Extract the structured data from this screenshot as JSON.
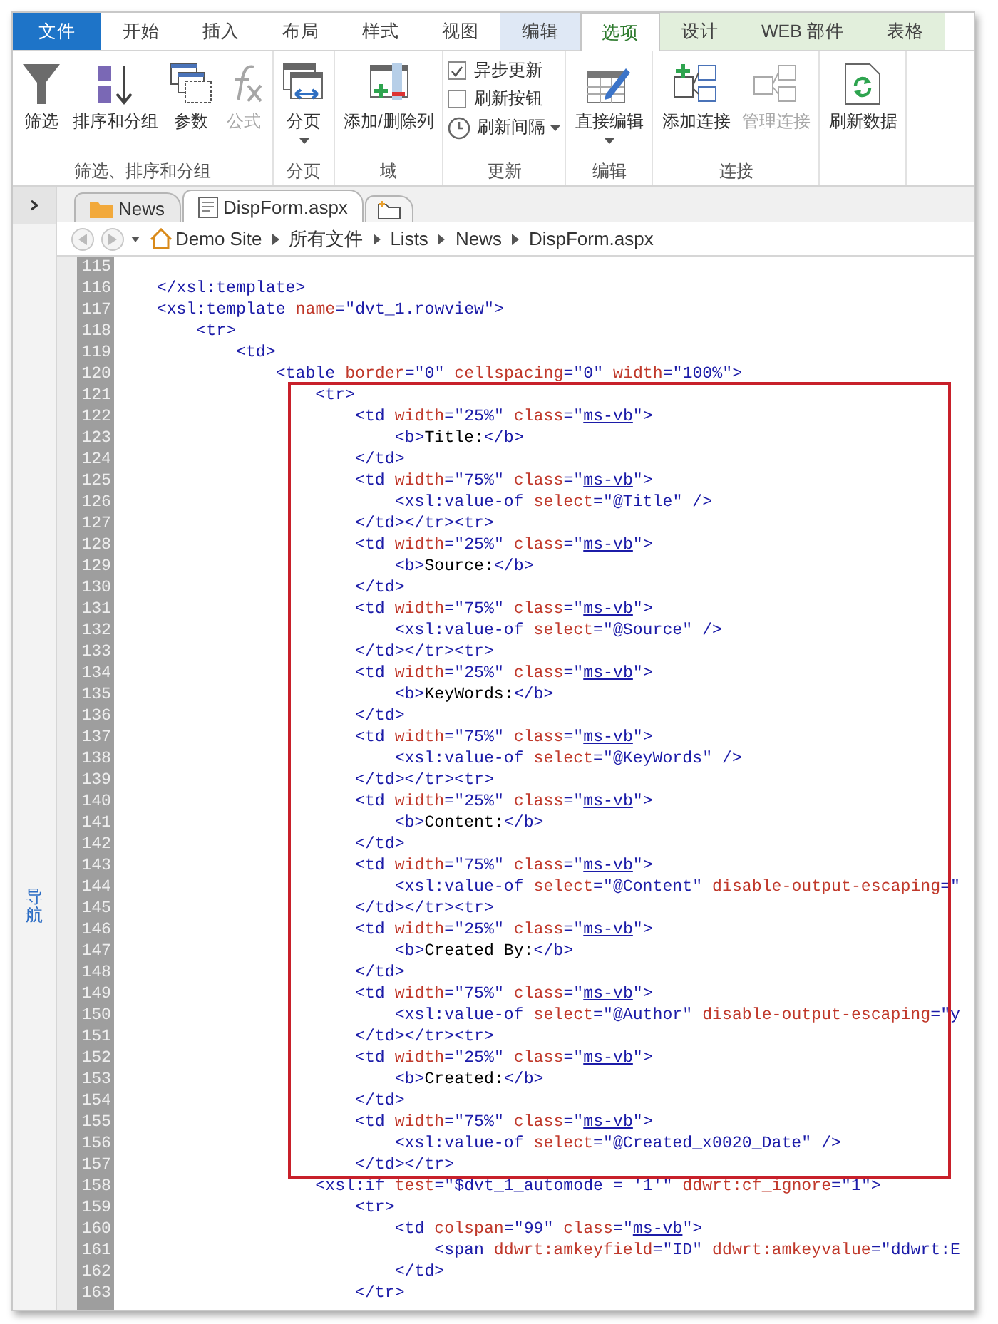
{
  "ribbon": {
    "tabs": [
      {
        "label": "文件",
        "kind": "file",
        "selected": false
      },
      {
        "label": "开始",
        "kind": "plain",
        "selected": false
      },
      {
        "label": "插入",
        "kind": "plain",
        "selected": false
      },
      {
        "label": "布局",
        "kind": "plain",
        "selected": false
      },
      {
        "label": "样式",
        "kind": "plain",
        "selected": false
      },
      {
        "label": "视图",
        "kind": "plain",
        "selected": false
      },
      {
        "label": "编辑",
        "kind": "context",
        "color": "#dfe8f5",
        "selected": false
      },
      {
        "label": "选项",
        "kind": "context",
        "selected": true
      },
      {
        "label": "设计",
        "kind": "context",
        "color": "#e2efdc",
        "selected": false
      },
      {
        "label": "WEB 部件",
        "kind": "context",
        "color": "#e2efdc",
        "selected": false
      },
      {
        "label": "表格",
        "kind": "context",
        "color": "#e2efdc",
        "selected": false
      }
    ],
    "groups": [
      {
        "label": "筛选、排序和分组",
        "items": [
          {
            "kind": "large",
            "label": "筛选",
            "disabled": false,
            "dropdown": false
          },
          {
            "kind": "large",
            "label": "排序和分组",
            "disabled": false,
            "dropdown": false
          },
          {
            "kind": "large",
            "label": "参数",
            "disabled": false,
            "dropdown": false
          },
          {
            "kind": "large",
            "label": "公式",
            "disabled": true,
            "dropdown": false
          }
        ]
      },
      {
        "label": "分页",
        "items": [
          {
            "kind": "large",
            "label": "分页",
            "disabled": false,
            "dropdown": true
          }
        ]
      },
      {
        "label": "域",
        "items": [
          {
            "kind": "large",
            "label": "添加/删除列",
            "disabled": false,
            "dropdown": false
          }
        ]
      },
      {
        "label": "更新",
        "items": [
          {
            "kind": "check",
            "label": "异步更新",
            "checked": true
          },
          {
            "kind": "check",
            "label": "刷新按钮",
            "checked": false
          },
          {
            "kind": "small",
            "label": "刷新间隔",
            "disabled": false,
            "dropdown": true
          }
        ]
      },
      {
        "label": "编辑",
        "items": [
          {
            "kind": "large",
            "label": "直接编辑",
            "disabled": false,
            "dropdown": true
          }
        ]
      },
      {
        "label": "连接",
        "items": [
          {
            "kind": "large",
            "label": "添加连接",
            "disabled": false,
            "dropdown": false
          },
          {
            "kind": "large",
            "label": "管理连接",
            "disabled": true,
            "dropdown": false
          }
        ]
      },
      {
        "items": [
          {
            "kind": "large",
            "label": "刷新数据",
            "disabled": false,
            "dropdown": false
          }
        ]
      }
    ]
  },
  "nav_pane": {
    "label": "导航"
  },
  "document_tabs": [
    {
      "label": "News",
      "kind": "folder",
      "selected": false
    },
    {
      "label": "DispForm.aspx",
      "kind": "page",
      "selected": true
    }
  ],
  "breadcrumb": [
    "Demo Site",
    "所有文件",
    "Lists",
    "News",
    "DispForm.aspx"
  ],
  "code_lines": [
    {
      "n": "115"
    },
    {
      "n": "116",
      "code": "    </xsl:template>"
    },
    {
      "n": "117",
      "code": "    <xsl:template name=\"dvt_1.rowview\">",
      "link": false
    },
    {
      "n": "118",
      "code": "        <tr>"
    },
    {
      "n": "119",
      "code": "            <td>"
    },
    {
      "n": "120",
      "code": "                <table border=\"0\" cellspacing=\"0\" width=\"100%\">",
      "link": false
    },
    {
      "n": "121",
      "code": "                    <tr>"
    },
    {
      "n": "122",
      "code": "                        <td width=\"25%\" class=\"ms-vb\">",
      "link": true
    },
    {
      "n": "123",
      "code": "                            <b>Title:</b>"
    },
    {
      "n": "124",
      "code": "                        </td>"
    },
    {
      "n": "125",
      "code": "                        <td width=\"75%\" class=\"ms-vb\">",
      "link": true
    },
    {
      "n": "126",
      "code": "                            <xsl:value-of select=\"@Title\" />",
      "link": false
    },
    {
      "n": "127",
      "code": "                        </td></tr><tr>"
    },
    {
      "n": "128",
      "code": "                        <td width=\"25%\" class=\"ms-vb\">",
      "link": true
    },
    {
      "n": "129",
      "code": "                            <b>Source:</b>"
    },
    {
      "n": "130",
      "code": "                        </td>"
    },
    {
      "n": "131",
      "code": "                        <td width=\"75%\" class=\"ms-vb\">",
      "link": true
    },
    {
      "n": "132",
      "code": "                            <xsl:value-of select=\"@Source\" />",
      "link": false
    },
    {
      "n": "133",
      "code": "                        </td></tr><tr>"
    },
    {
      "n": "134",
      "code": "                        <td width=\"25%\" class=\"ms-vb\">",
      "link": true
    },
    {
      "n": "135",
      "code": "                            <b>KeyWords:</b>"
    },
    {
      "n": "136",
      "code": "                        </td>"
    },
    {
      "n": "137",
      "code": "                        <td width=\"75%\" class=\"ms-vb\">",
      "link": true
    },
    {
      "n": "138",
      "code": "                            <xsl:value-of select=\"@KeyWords\" />",
      "link": false
    },
    {
      "n": "139",
      "code": "                        </td></tr><tr>"
    },
    {
      "n": "140",
      "code": "                        <td width=\"25%\" class=\"ms-vb\">",
      "link": true
    },
    {
      "n": "141",
      "code": "                            <b>Content:</b>"
    },
    {
      "n": "142",
      "code": "                        </td>"
    },
    {
      "n": "143",
      "code": "                        <td width=\"75%\" class=\"ms-vb\">",
      "link": true
    },
    {
      "n": "144",
      "code": "                            <xsl:value-of select=\"@Content\" disable-output-escaping=\""
    },
    {
      "n": "145",
      "code": "                        </td></tr><tr>"
    },
    {
      "n": "146",
      "code": "                        <td width=\"25%\" class=\"ms-vb\">",
      "link": true
    },
    {
      "n": "147",
      "code": "                            <b>Created By:</b>"
    },
    {
      "n": "148",
      "code": "                        </td>"
    },
    {
      "n": "149",
      "code": "                        <td width=\"75%\" class=\"ms-vb\">",
      "link": true
    },
    {
      "n": "150",
      "code": "                            <xsl:value-of select=\"@Author\" disable-output-escaping=\"y",
      "link": false
    },
    {
      "n": "151",
      "code": "                        </td></tr><tr>"
    },
    {
      "n": "152",
      "code": "                        <td width=\"25%\" class=\"ms-vb\">",
      "link": true
    },
    {
      "n": "153",
      "code": "                            <b>Created:</b>"
    },
    {
      "n": "154",
      "code": "                        </td>"
    },
    {
      "n": "155",
      "code": "                        <td width=\"75%\" class=\"ms-vb\">",
      "link": true
    },
    {
      "n": "156",
      "code": "                            <xsl:value-of select=\"@Created_x0020_Date\" />",
      "link": false
    },
    {
      "n": "157",
      "code": "                        </td></tr>"
    },
    {
      "n": "158",
      "code": "                    <xsl:if test=\"$dvt_1_automode = '1'\" ddwrt:cf_ignore=\"1\">",
      "link": false
    },
    {
      "n": "159",
      "code": "                        <tr>"
    },
    {
      "n": "160",
      "code": "                            <td colspan=\"99\" class=\"ms-vb\">",
      "link": true
    },
    {
      "n": "161",
      "code": "                                <span ddwrt:amkeyfield=\"ID\" ddwrt:amkeyvalue=\"ddwrt:E",
      "link": false
    },
    {
      "n": "162",
      "code": "                            </td>"
    },
    {
      "n": "163",
      "code": "                        </tr>"
    }
  ]
}
